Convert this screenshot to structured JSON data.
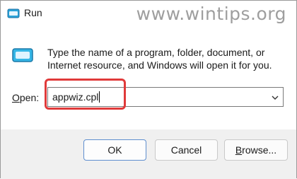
{
  "window": {
    "title": "Run"
  },
  "watermark": "www.wintips.org",
  "dialog": {
    "description": "Type the name of a program, folder, document, or Internet resource, and Windows will open it for you.",
    "open_label_prefix": "O",
    "open_label_suffix": "pen:",
    "open_value": "appwiz.cpl"
  },
  "buttons": {
    "ok": "OK",
    "cancel": "Cancel",
    "browse_prefix": "B",
    "browse_suffix": "rowse..."
  },
  "colors": {
    "highlight": "#e03a3a",
    "accent": "#0067c0"
  },
  "icons": {
    "title": "run-icon",
    "app": "run-app-icon",
    "dropdown": "chevron-down-icon"
  }
}
